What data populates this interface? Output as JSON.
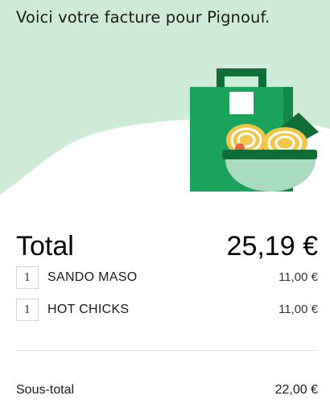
{
  "header": {
    "title": "Voici votre facture pour Pignouf.",
    "illustration": "shopping-bag-with-noodle-bowl",
    "background_color": "#cdebd6",
    "accent_color": "#1aa35a"
  },
  "total": {
    "label": "Total",
    "value": "25,19 €"
  },
  "items": [
    {
      "quantity": "1",
      "name": "SANDO MASO",
      "price": "11,00 €"
    },
    {
      "quantity": "1",
      "name": "HOT CHICKS",
      "price": "11,00 €"
    }
  ],
  "subtotal": {
    "label": "Sous-total",
    "value": "22,00 €"
  }
}
